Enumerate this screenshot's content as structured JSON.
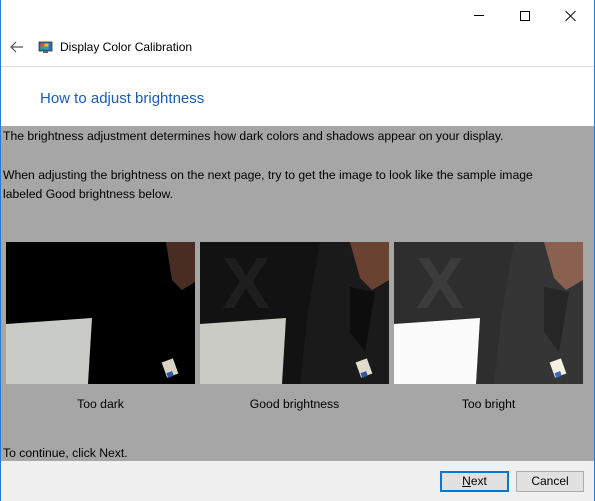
{
  "window": {
    "title": "Display Color Calibration",
    "controls": [
      "minimize",
      "maximize",
      "close"
    ]
  },
  "nav": {
    "back_icon": "back-arrow-icon",
    "app_icon": "display-calibration-icon"
  },
  "header": {
    "title": "How to adjust brightness"
  },
  "content": {
    "paragraph1": "The brightness adjustment determines how dark colors and shadows appear on your display.",
    "paragraph2": "When adjusting the brightness on the next page, try to get the image to look like the sample image labeled Good brightness below.",
    "samples": [
      {
        "caption": "Too dark"
      },
      {
        "caption": "Good brightness"
      },
      {
        "caption": "Too bright"
      }
    ],
    "continue_text": "To continue, click Next."
  },
  "footer": {
    "next_label": "Next",
    "cancel_label": "Cancel"
  },
  "colors": {
    "accent": "#0078d7",
    "title_blue": "#1c5bb2",
    "content_bg": "#a6a6a6",
    "footer_bg": "#f0f0f0"
  }
}
